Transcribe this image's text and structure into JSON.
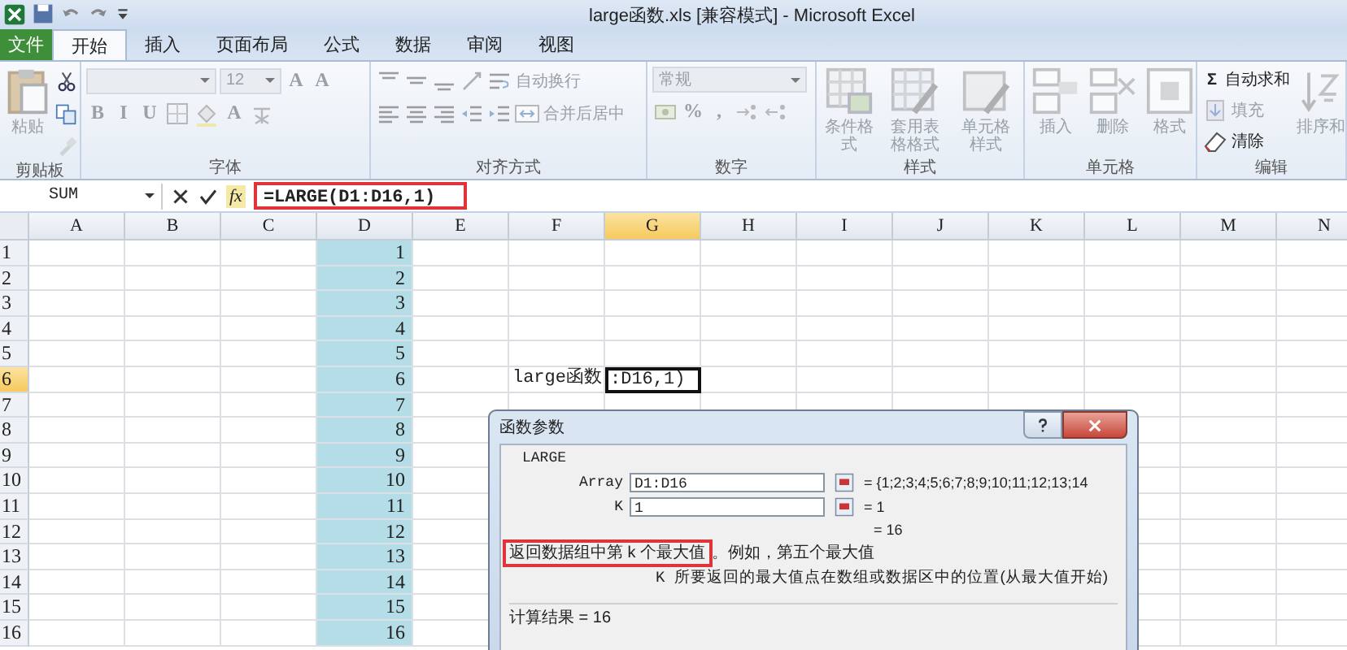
{
  "title_bar": {
    "title": "large函数.xls  [兼容模式]  -  Microsoft Excel"
  },
  "file_tab": "文件",
  "tabs": [
    {
      "label": "开始",
      "selected": true
    },
    {
      "label": "插入",
      "selected": false
    },
    {
      "label": "页面布局",
      "selected": false
    },
    {
      "label": "公式",
      "selected": false
    },
    {
      "label": "数据",
      "selected": false
    },
    {
      "label": "审阅",
      "selected": false
    },
    {
      "label": "视图",
      "selected": false
    }
  ],
  "ribbon": [
    {
      "label": "剪贴板",
      "columns": [
        [
          [
            {
              "kind": "large",
              "label": "粘贴",
              "disabled": true
            }
          ]
        ],
        [
          [
            {
              "kind": "icon",
              "disabled": false
            }
          ],
          [
            {
              "kind": "icon",
              "disabled": false
            }
          ],
          [
            {
              "kind": "icon",
              "disabled": true
            }
          ]
        ]
      ]
    },
    {
      "label": "字体",
      "columns": [
        [
          [
            {
              "kind": "field",
              "disabled": true
            },
            {
              "kind": "field",
              "value": "12",
              "disabled": true
            },
            {
              "kind": "glyph",
              "text": "A",
              "disabled": true
            },
            {
              "kind": "glyph",
              "text": "A",
              "disabled": true
            }
          ],
          [
            {
              "kind": "glyph",
              "text": "B",
              "disabled": true
            },
            {
              "kind": "glyph",
              "text": "I",
              "disabled": true
            },
            {
              "kind": "glyph",
              "text": "U",
              "disabled": true
            },
            {
              "kind": "icon",
              "disabled": true
            },
            {
              "kind": "icon",
              "disabled": true
            },
            {
              "kind": "glyph",
              "text": "A",
              "disabled": true
            },
            {
              "kind": "icon",
              "disabled": true
            }
          ]
        ]
      ]
    },
    {
      "label": "对齐方式",
      "columns": [
        [
          [
            {
              "kind": "icon",
              "disabled": true
            },
            {
              "kind": "icon",
              "disabled": true
            },
            {
              "kind": "icon",
              "disabled": true
            },
            {
              "kind": "icon",
              "disabled": true
            },
            {
              "kind": "small",
              "label": "自动换行",
              "disabled": true
            }
          ],
          [
            {
              "kind": "icon",
              "disabled": true
            },
            {
              "kind": "icon",
              "disabled": true
            },
            {
              "kind": "icon",
              "disabled": true
            },
            {
              "kind": "icon",
              "disabled": true
            },
            {
              "kind": "icon",
              "disabled": true
            },
            {
              "kind": "small",
              "label": "合并后居中",
              "disabled": true
            }
          ]
        ]
      ]
    },
    {
      "label": "数字",
      "columns": [
        [
          [
            {
              "kind": "field",
              "value": "常规",
              "disabled": true
            }
          ],
          [
            {
              "kind": "icon",
              "disabled": true
            },
            {
              "kind": "glyph",
              "text": "%",
              "disabled": true
            },
            {
              "kind": "glyph",
              "text": ",",
              "disabled": true
            },
            {
              "kind": "icon",
              "disabled": true
            },
            {
              "kind": "icon",
              "disabled": true
            }
          ]
        ]
      ]
    },
    {
      "label": "样式",
      "columns": [
        [
          [
            {
              "kind": "large",
              "label": "条件格式",
              "disabled": true
            }
          ]
        ],
        [
          [
            {
              "kind": "large",
              "label": "套用表格格式",
              "disabled": true
            }
          ]
        ],
        [
          [
            {
              "kind": "large",
              "label": "单元格样式",
              "disabled": true
            }
          ]
        ]
      ]
    },
    {
      "label": "单元格",
      "columns": [
        [
          [
            {
              "kind": "large",
              "label": "插入",
              "disabled": true
            }
          ]
        ],
        [
          [
            {
              "kind": "large",
              "label": "删除",
              "disabled": true
            }
          ]
        ],
        [
          [
            {
              "kind": "large",
              "label": "格式",
              "disabled": true
            }
          ]
        ]
      ]
    },
    {
      "label": "编辑",
      "columns": [
        [
          [
            {
              "kind": "small",
              "glyph": "Σ",
              "label": "自动求和",
              "disabled": false
            }
          ],
          [
            {
              "kind": "small",
              "label": "填充",
              "disabled": true
            }
          ],
          [
            {
              "kind": "small",
              "label": "清除",
              "disabled": false
            }
          ]
        ],
        [
          [
            {
              "kind": "large",
              "label": "排序和",
              "disabled": true
            }
          ]
        ]
      ]
    }
  ],
  "formula_bar": {
    "name_box": "SUM",
    "function_label": "fx",
    "formula": "=LARGE(D1:D16,1)",
    "highlighted": true
  },
  "sheet": {
    "columns": [
      {
        "label": "A",
        "selected": false
      },
      {
        "label": "B",
        "selected": false
      },
      {
        "label": "C",
        "selected": false
      },
      {
        "label": "D",
        "selected": false
      },
      {
        "label": "E",
        "selected": false
      },
      {
        "label": "F",
        "selected": false
      },
      {
        "label": "G",
        "selected": true
      },
      {
        "label": "H",
        "selected": false
      },
      {
        "label": "I",
        "selected": false
      },
      {
        "label": "J",
        "selected": false
      },
      {
        "label": "K",
        "selected": false
      },
      {
        "label": "L",
        "selected": false
      },
      {
        "label": "M",
        "selected": false
      },
      {
        "label": "N",
        "selected": false
      }
    ],
    "rows": [
      {
        "label": "1",
        "selected": false
      },
      {
        "label": "2",
        "selected": false
      },
      {
        "label": "3",
        "selected": false
      },
      {
        "label": "4",
        "selected": false
      },
      {
        "label": "5",
        "selected": false
      },
      {
        "label": "6",
        "selected": true
      },
      {
        "label": "7",
        "selected": false
      },
      {
        "label": "8",
        "selected": false
      },
      {
        "label": "9",
        "selected": false
      },
      {
        "label": "10",
        "selected": false
      },
      {
        "label": "11",
        "selected": false
      },
      {
        "label": "12",
        "selected": false
      },
      {
        "label": "13",
        "selected": false
      },
      {
        "label": "14",
        "selected": false
      },
      {
        "label": "15",
        "selected": false
      },
      {
        "label": "16",
        "selected": false
      }
    ],
    "range_values": [
      "1",
      "2",
      "3",
      "4",
      "5",
      "6",
      "7",
      "8",
      "9",
      "10",
      "11",
      "12",
      "13",
      "14",
      "15",
      "16"
    ],
    "label_cell": "large函数",
    "active_cell": ":D16,1)"
  },
  "dialog": {
    "title": "函数参数",
    "function": "LARGE",
    "arguments": [
      {
        "label": "Array",
        "value": "D1:D16",
        "result": "=  {1;2;3;4;5;6;7;8;9;10;11;12;13;14"
      },
      {
        "label": "K",
        "value": "1",
        "result": "=  1"
      }
    ],
    "result": "=  16",
    "description": {
      "highlight": "返回数据组中第 k 个最大值",
      "rest": "。例如，第五个最大值",
      "highlighted": true
    },
    "argument_name": "K",
    "argument_help": "所要返回的最大值点在数组或数据区中的位置(从最大值开始)",
    "calculation": "计算结果 = 16"
  }
}
